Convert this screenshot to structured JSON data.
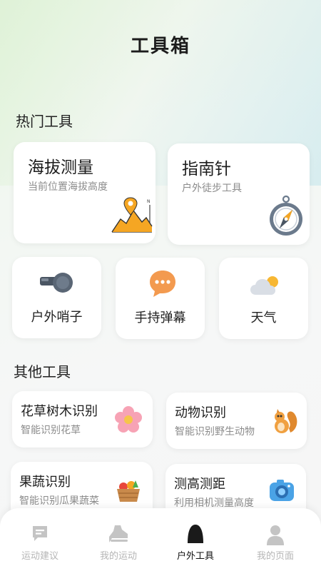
{
  "page_title": "工具箱",
  "sections": {
    "hot": "热门工具",
    "other": "其他工具"
  },
  "hot_tools": {
    "altitude": {
      "title": "海拔测量",
      "subtitle": "当前位置海拔高度",
      "icon": "mountain-icon"
    },
    "compass": {
      "title": "指南针",
      "subtitle": "户外徒步工具",
      "icon": "compass-icon"
    },
    "whistle": {
      "title": "户外哨子",
      "icon": "whistle-icon"
    },
    "barrage": {
      "title": "手持弹幕",
      "icon": "chat-bubble-icon"
    },
    "weather": {
      "title": "天气",
      "icon": "weather-icon"
    }
  },
  "other_tools": [
    {
      "title": "花草树木识别",
      "subtitle": "智能识别花草",
      "icon": "flower-icon"
    },
    {
      "title": "动物识别",
      "subtitle": "智能识别野生动物",
      "icon": "squirrel-icon"
    },
    {
      "title": "果蔬识别",
      "subtitle": "智能识别瓜果蔬菜",
      "icon": "fruit-basket-icon"
    },
    {
      "title": "测高测距",
      "subtitle": "利用相机测量高度",
      "icon": "camera-icon"
    }
  ],
  "tabs": [
    {
      "label": "运动建议",
      "icon": "chat-icon",
      "active": false
    },
    {
      "label": "我的运动",
      "icon": "shoe-icon",
      "active": false
    },
    {
      "label": "户外工具",
      "icon": "tent-icon",
      "active": true
    },
    {
      "label": "我的页面",
      "icon": "user-icon",
      "active": false
    }
  ],
  "colors": {
    "accent": "#f5a623",
    "text": "#222222",
    "subtext": "#8c8c8c",
    "tab_inactive": "#b5b5b5"
  }
}
